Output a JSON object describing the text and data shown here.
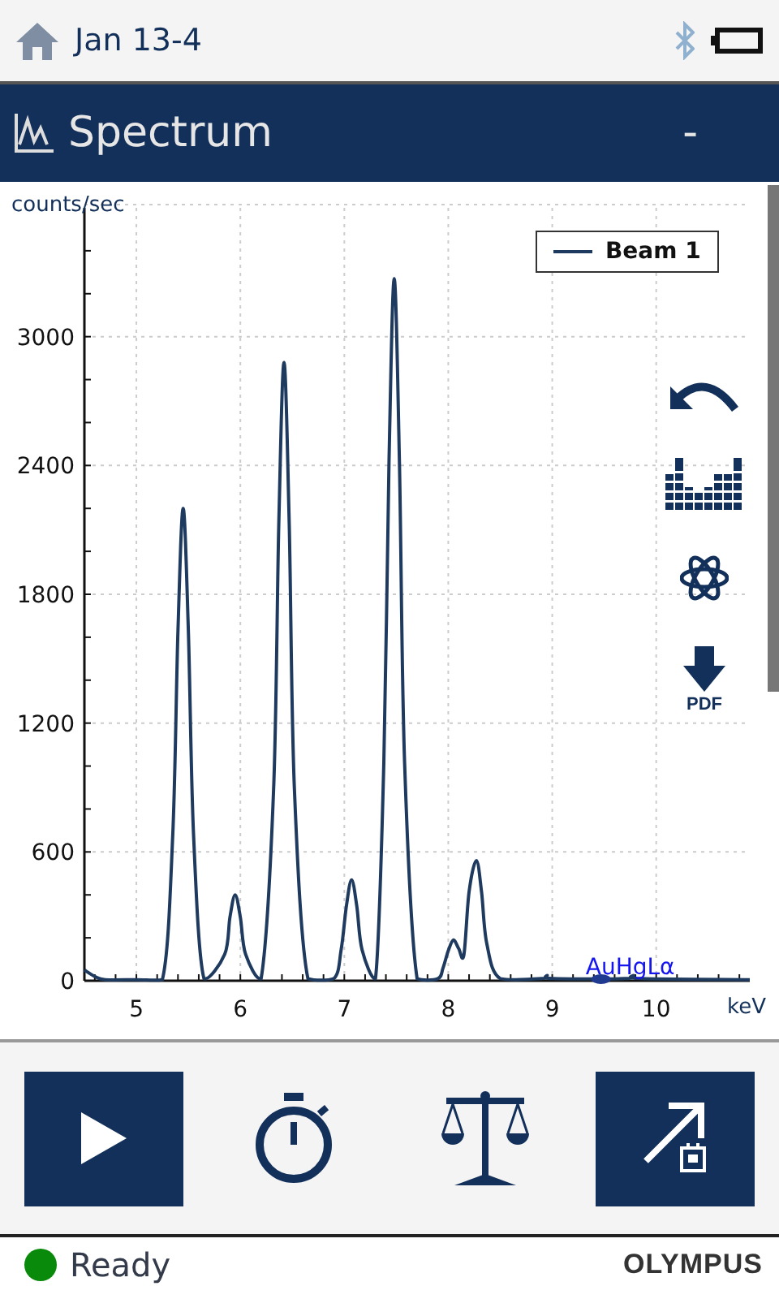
{
  "top_bar": {
    "title": "Jan 13-4"
  },
  "title_bar": {
    "title": "Spectrum",
    "value": "-"
  },
  "spectrum": {
    "pdf_label": "PDF",
    "chart_data": {
      "type": "line",
      "grid": true,
      "xlabel": "keV",
      "ylabel": "counts/sec",
      "xlim": [
        4.5,
        10.9
      ],
      "ylim": [
        0,
        3600
      ],
      "xticks": [
        5,
        6,
        7,
        8,
        9,
        10
      ],
      "yticks": [
        0,
        600,
        1200,
        1800,
        2400,
        3000
      ],
      "x": [
        4.5,
        4.6,
        4.7,
        5.0,
        5.25,
        5.35,
        5.4,
        5.45,
        5.5,
        5.55,
        5.65,
        5.85,
        5.9,
        5.95,
        6.0,
        6.05,
        6.2,
        6.32,
        6.37,
        6.42,
        6.47,
        6.52,
        6.65,
        6.9,
        6.97,
        7.02,
        7.07,
        7.12,
        7.17,
        7.3,
        7.38,
        7.43,
        7.48,
        7.53,
        7.58,
        7.7,
        7.9,
        7.95,
        8.0,
        8.05,
        8.1,
        8.15,
        8.2,
        8.27,
        8.32,
        8.37,
        8.5,
        8.9,
        8.95,
        9.0,
        9.7,
        9.78,
        9.85,
        10.9
      ],
      "series": [
        {
          "name": "Beam 1",
          "color": "#1f3a5f",
          "values": [
            50,
            20,
            5,
            5,
            5,
            680,
            1630,
            2200,
            1630,
            680,
            10,
            124,
            296,
            400,
            296,
            124,
            10,
            893,
            2130,
            2880,
            2130,
            893,
            10,
            10,
            146,
            348,
            470,
            348,
            146,
            10,
            1014,
            2420,
            3270,
            2420,
            1014,
            10,
            10,
            60,
            140,
            190,
            150,
            120,
            414,
            560,
            414,
            174,
            10,
            10,
            25,
            10,
            10,
            25,
            10,
            5
          ]
        }
      ],
      "annotations": [
        {
          "x": 9.75,
          "text": "AuHgLα"
        }
      ]
    }
  },
  "toolbar": [
    {
      "highlighted": true
    },
    {
      "highlighted": false
    },
    {
      "highlighted": false
    },
    {
      "highlighted": true
    }
  ],
  "status_bar": {
    "text": "Ready",
    "brand": "OLYMPUS"
  }
}
